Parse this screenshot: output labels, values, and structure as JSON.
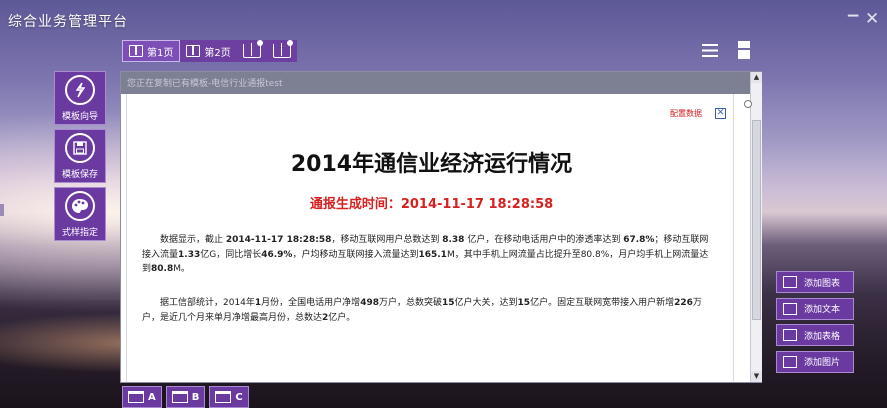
{
  "app": {
    "title": "综合业务管理平台"
  },
  "window": {
    "minimize": "−",
    "close": "✕"
  },
  "page_tabs": [
    {
      "label": "第1页",
      "active": true
    },
    {
      "label": "第2页",
      "active": false
    }
  ],
  "side_tools": [
    {
      "label": "模板向导",
      "icon": "wand-icon"
    },
    {
      "label": "模板保存",
      "icon": "save-icon"
    },
    {
      "label": "式样指定",
      "icon": "palette-icon"
    }
  ],
  "panel": {
    "hint": "您正在复制已有模板-电信行业通报test",
    "config_link": "配置数据",
    "close": "✕"
  },
  "document": {
    "title": "2014年通信业经济运行情况",
    "time_label": "通报生成时间：",
    "time_value": "2014-11-17 18:28:58",
    "p1": {
      "t1": "数据显示，截止 ",
      "b1": "2014-11-17 18:28:58",
      "t2": "，移动互联网用户总数达到 ",
      "b2": "8.38",
      "t3": " 亿户，在移动电话用户中的渗透率达到 ",
      "b3": "67.8%",
      "t4": "；移动互联网接入流量",
      "b4": "1.33",
      "t5": "亿G，同比增长",
      "b5": "46.9%",
      "t6": "，户均移动互联网接入流量达到",
      "b6": "165.1",
      "t7": "M，其中手机上网流量占比提升至80.8%，月户均手机上网流量达到",
      "b7": "80.8",
      "t8": "M。"
    },
    "p2": {
      "t1": "据工信部统计，2014年",
      "b1": "1",
      "t2": "月份，全国电话用户净增",
      "b2": "498",
      "t3": "万户，总数突破",
      "b3": "15",
      "t4": "亿户大关，达到",
      "b4": "15",
      "t5": "亿户。固定互联网宽带接入用户新增",
      "b5": "226",
      "t6": "万户，是近几个月来单月净增最高月份，总数达",
      "b6": "2",
      "t7": "亿户。"
    }
  },
  "right_tools": [
    {
      "label": "添加图表"
    },
    {
      "label": "添加文本"
    },
    {
      "label": "添加表格"
    },
    {
      "label": "添加图片"
    }
  ],
  "bottom_tabs": [
    {
      "label": "A"
    },
    {
      "label": "B"
    },
    {
      "label": "C"
    }
  ],
  "colors": {
    "accent": "#6b3aa1",
    "time_red": "#d82020"
  }
}
